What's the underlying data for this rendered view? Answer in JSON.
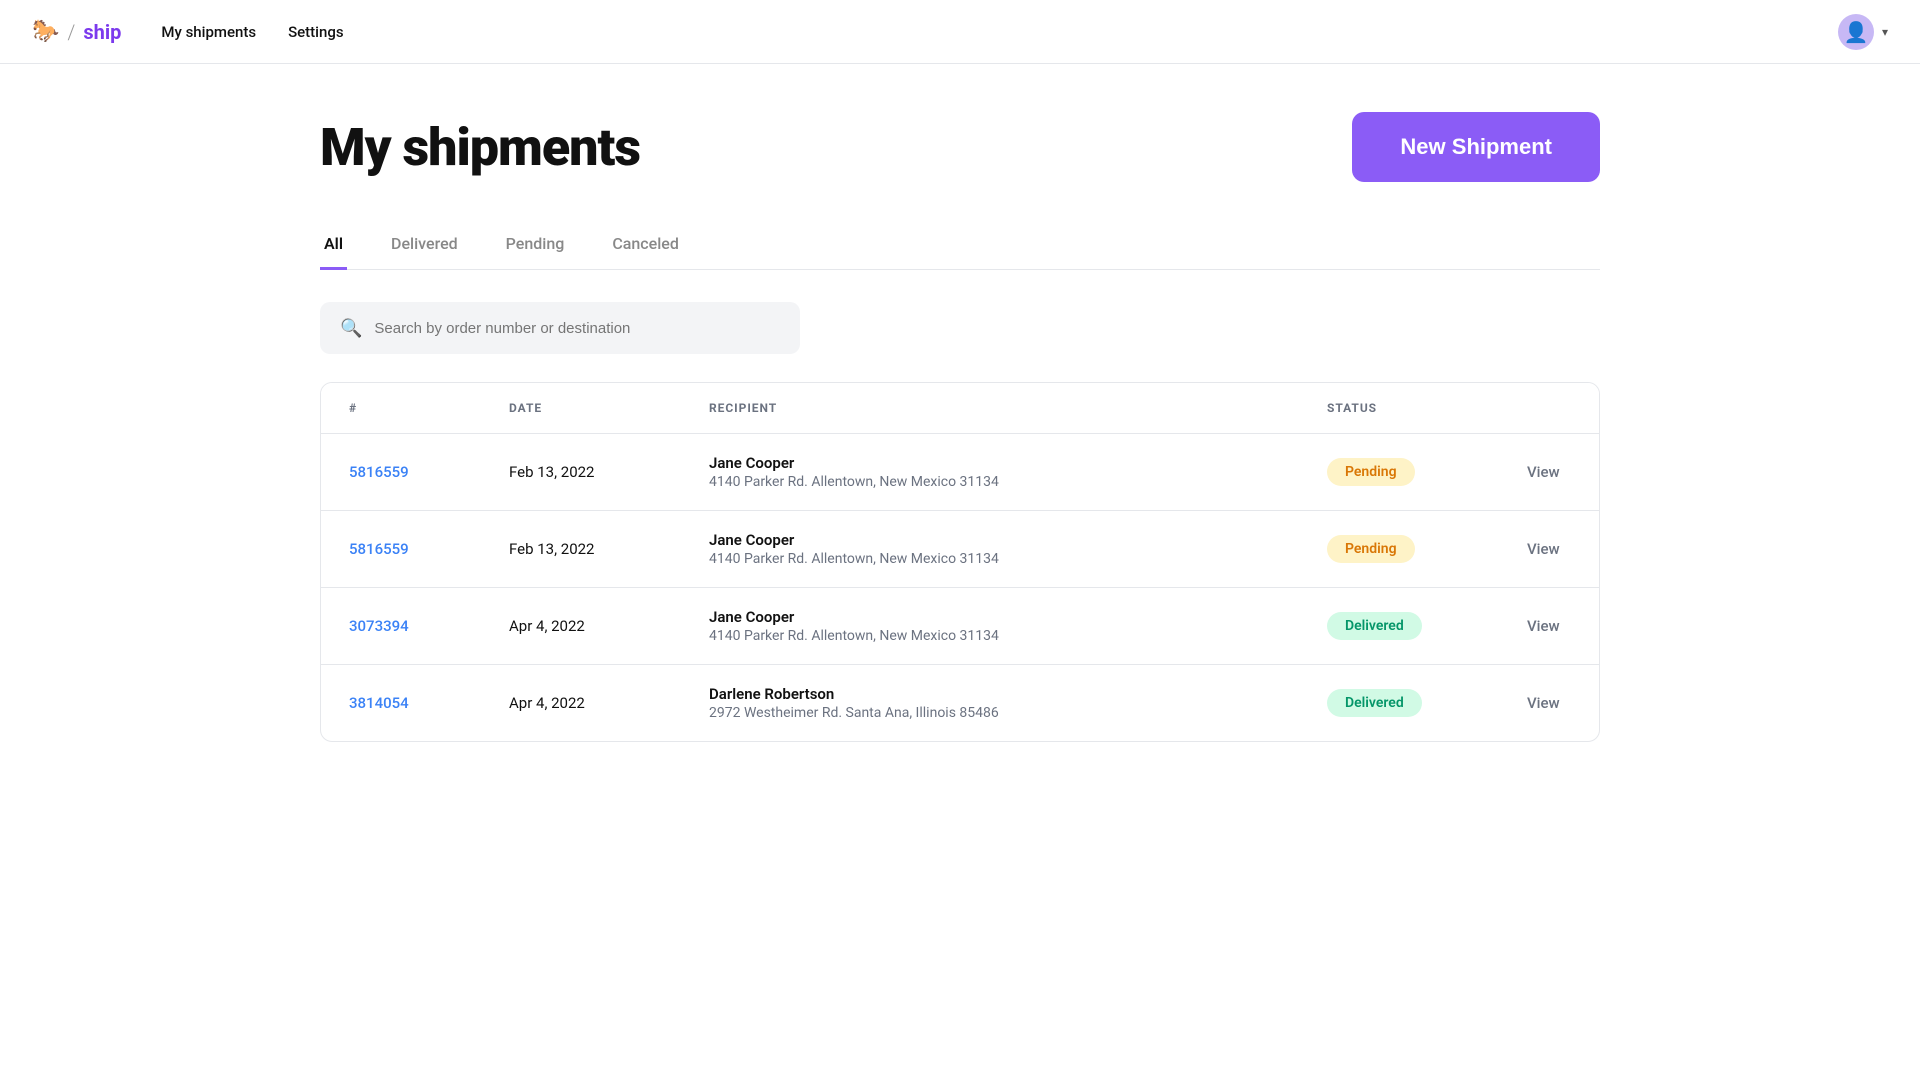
{
  "app": {
    "logo_icon": "🐎",
    "logo_text": "ship",
    "logo_divider": "/",
    "nav_links": [
      {
        "label": "My shipments",
        "active": true
      },
      {
        "label": "Settings",
        "active": false
      }
    ]
  },
  "header": {
    "title": "My shipments",
    "new_shipment_label": "New Shipment"
  },
  "tabs": [
    {
      "label": "All",
      "active": true
    },
    {
      "label": "Delivered",
      "active": false
    },
    {
      "label": "Pending",
      "active": false
    },
    {
      "label": "Canceled",
      "active": false
    }
  ],
  "search": {
    "placeholder": "Search by order number or destination"
  },
  "table": {
    "columns": [
      {
        "key": "number",
        "label": "#"
      },
      {
        "key": "date",
        "label": "DATE"
      },
      {
        "key": "recipient",
        "label": "RECIPIENT"
      },
      {
        "key": "status",
        "label": "STATUS"
      },
      {
        "key": "action",
        "label": ""
      }
    ],
    "rows": [
      {
        "id": "row-1",
        "number": "5816559",
        "date": "Feb 13, 2022",
        "recipient_name": "Jane Cooper",
        "recipient_address": "4140 Parker Rd. Allentown, New Mexico 31134",
        "status": "Pending",
        "status_class": "pending",
        "action": "View"
      },
      {
        "id": "row-2",
        "number": "5816559",
        "date": "Feb 13, 2022",
        "recipient_name": "Jane Cooper",
        "recipient_address": "4140 Parker Rd. Allentown, New Mexico 31134",
        "status": "Pending",
        "status_class": "pending",
        "action": "View"
      },
      {
        "id": "row-3",
        "number": "3073394",
        "date": "Apr 4, 2022",
        "recipient_name": "Jane Cooper",
        "recipient_address": "4140 Parker Rd. Allentown, New Mexico 31134",
        "status": "Delivered",
        "status_class": "delivered",
        "action": "View"
      },
      {
        "id": "row-4",
        "number": "3814054",
        "date": "Apr 4, 2022",
        "recipient_name": "Darlene Robertson",
        "recipient_address": "2972 Westheimer Rd. Santa Ana, Illinois 85486",
        "status": "Delivered",
        "status_class": "delivered",
        "action": "View"
      }
    ]
  }
}
